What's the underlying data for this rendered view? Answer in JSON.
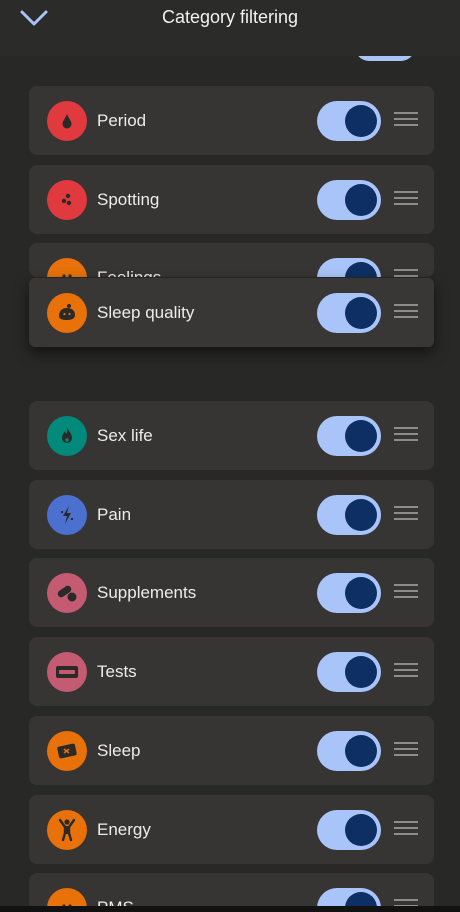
{
  "header": {
    "title": "Category filtering"
  },
  "colors": {
    "toggle_track": "#a9c4f9",
    "toggle_knob": "#0d2f63",
    "period": "#e0393e",
    "spotting": "#e0393e",
    "feelings": "#e8710a",
    "sleep_quality": "#e8710a",
    "sex_life": "#01897b",
    "pain": "#4c70d0",
    "supplements": "#c45b73",
    "tests": "#c45b73",
    "sleep": "#e8710a",
    "energy": "#e8710a",
    "pms": "#e8710a"
  },
  "categories": [
    {
      "label": "Period",
      "icon": "drop-icon",
      "enabled": true
    },
    {
      "label": "Spotting",
      "icon": "dots-icon",
      "enabled": true
    },
    {
      "label": "Feelings",
      "icon": "face-icon",
      "enabled": true
    },
    {
      "label": "Sleep quality",
      "icon": "sleep-quality-icon",
      "enabled": true,
      "dragging": true
    },
    {
      "label": "Sex life",
      "icon": "flame-icon",
      "enabled": true
    },
    {
      "label": "Pain",
      "icon": "lightning-icon",
      "enabled": true
    },
    {
      "label": "Supplements",
      "icon": "pill-icon",
      "enabled": true
    },
    {
      "label": "Tests",
      "icon": "test-strip-icon",
      "enabled": true
    },
    {
      "label": "Sleep",
      "icon": "pillow-icon",
      "enabled": true
    },
    {
      "label": "Energy",
      "icon": "person-icon",
      "enabled": true
    },
    {
      "label": "PMS",
      "icon": "pms-icon",
      "enabled": true
    }
  ]
}
